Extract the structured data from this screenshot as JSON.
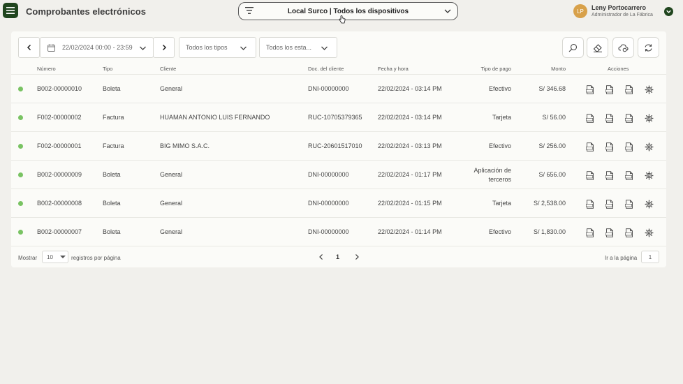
{
  "header": {
    "title": "Comprobantes electrónicos",
    "store_selector": "Local Surco | Todos los dispositivos",
    "user": {
      "initials": "LP",
      "name": "Leny Portocarrero",
      "role": "Administrador de La Fábrica"
    }
  },
  "filters": {
    "date_range": "22/02/2024 00:00 - 23:59",
    "type": "Todos los tipos",
    "status": "Todos los esta..."
  },
  "table": {
    "columns": [
      "Número",
      "Tipo",
      "Cliente",
      "Doc. del cliente",
      "Fecha y hora",
      "Tipo de pago",
      "Monto",
      "Acciones"
    ],
    "rows": [
      {
        "numero": "B002-00000010",
        "tipo": "Boleta",
        "cliente": "General",
        "doc": "DNI-00000000",
        "fecha": "22/02/2024 - 03:14 PM",
        "pago": "Efectivo",
        "pago2": "",
        "monto": "S/ 346.68"
      },
      {
        "numero": "F002-00000002",
        "tipo": "Factura",
        "cliente": "HUAMAN ANTONIO LUIS FERNANDO",
        "doc": "RUC-10705379365",
        "fecha": "22/02/2024 - 03:14 PM",
        "pago": "Tarjeta",
        "pago2": "",
        "monto": "S/ 56.00"
      },
      {
        "numero": "F002-00000001",
        "tipo": "Factura",
        "cliente": "BIG MIMO S.A.C.",
        "doc": "RUC-20601517010",
        "fecha": "22/02/2024 - 03:13 PM",
        "pago": "Efectivo",
        "pago2": "",
        "monto": "S/ 256.00"
      },
      {
        "numero": "B002-00000009",
        "tipo": "Boleta",
        "cliente": "General",
        "doc": "DNI-00000000",
        "fecha": "22/02/2024 - 01:17 PM",
        "pago": "Aplicación de",
        "pago2": "terceros",
        "monto": "S/ 656.00"
      },
      {
        "numero": "B002-00000008",
        "tipo": "Boleta",
        "cliente": "General",
        "doc": "DNI-00000000",
        "fecha": "22/02/2024 - 01:15 PM",
        "pago": "Tarjeta",
        "pago2": "",
        "monto": "S/ 2,538.00"
      },
      {
        "numero": "B002-00000007",
        "tipo": "Boleta",
        "cliente": "General",
        "doc": "DNI-00000000",
        "fecha": "22/02/2024 - 01:14 PM",
        "pago": "Efectivo",
        "pago2": "",
        "monto": "S/ 1,830.00"
      }
    ],
    "action_icons": [
      "pdf-icon",
      "xml-icon",
      "cdr-icon",
      "gear-icon"
    ],
    "status_color": "#79c363"
  },
  "footer": {
    "show_label": "Mostrar",
    "per_page": "10",
    "per_page_label": "registros por página",
    "current_page": "1",
    "goto_label": "Ir a la página",
    "goto_value": "1"
  },
  "colors": {
    "brand": "#21461f",
    "avatar": "#d8a14a",
    "background": "#f1f0ec"
  }
}
